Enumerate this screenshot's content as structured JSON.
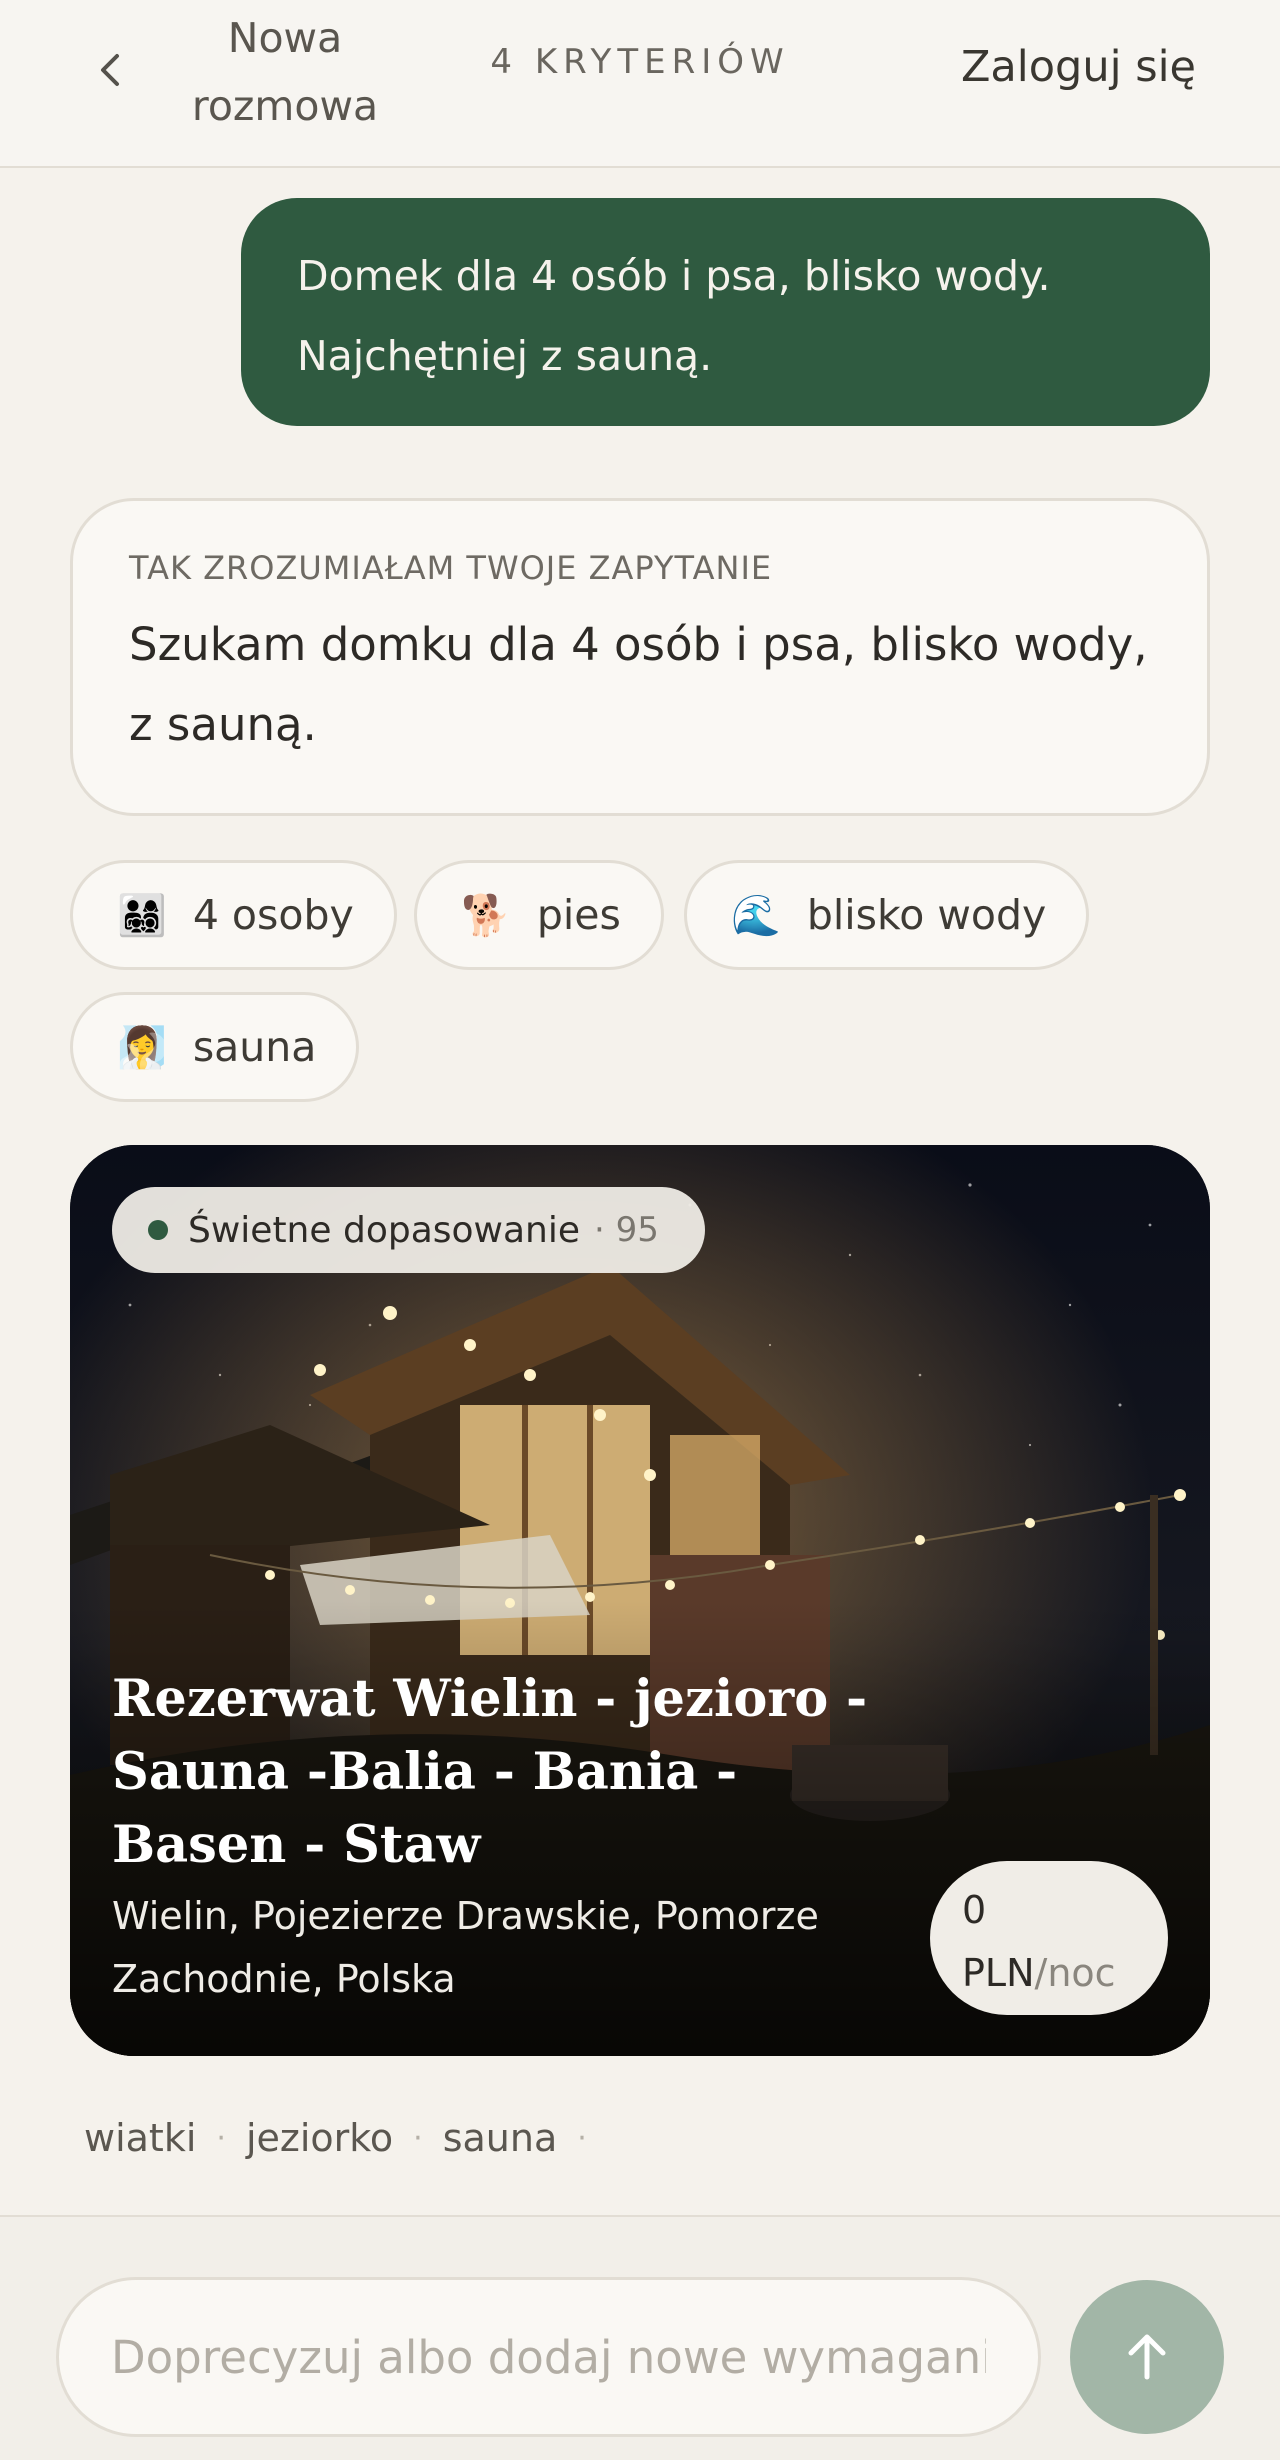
{
  "header": {
    "back_icon": "chevron-left-icon",
    "new_chat_label": "Nowa rozmowa",
    "criteria_label": "4 KRYTERIÓW",
    "login_label": "Zaloguj się"
  },
  "user_message": "Domek dla 4 osób i psa, blisko wody. Najchętniej z sauną.",
  "understanding": {
    "label": "TAK ZROZUMIAŁAM TWOJE ZAPYTANIE",
    "text": "Szukam domku dla 4 osób i psa, blisko wody, z sauną."
  },
  "criteria_chips": [
    {
      "emoji": "👨‍👩‍👧‍👦",
      "label": "4 osoby"
    },
    {
      "emoji": "🐕",
      "label": "pies"
    },
    {
      "emoji": "🌊",
      "label": "blisko wody"
    },
    {
      "emoji": "🧖‍♀️",
      "label": "sauna"
    }
  ],
  "listing": {
    "match_label": "Świetne dopasowanie",
    "match_score": "· 95",
    "title": "Rezerwat Wielin - jezioro - Sauna -Balia - Bania - Basen - Staw",
    "location": "Wielin, Pojezierze Drawskie, Pomorze Zachodnie, Polska",
    "price_value": "0 PLN",
    "price_unit": "/noc"
  },
  "tags": [
    "wiatki",
    "jeziorko",
    "sauna"
  ],
  "tag_separator": "·",
  "composer": {
    "placeholder": "Doprecyzuj albo dodaj nowe wymagania",
    "send_icon": "arrow-up-icon"
  },
  "colors": {
    "accent_green": "#2f5a40",
    "send_button": "#a2b6a7",
    "background": "#f5f2ec"
  }
}
